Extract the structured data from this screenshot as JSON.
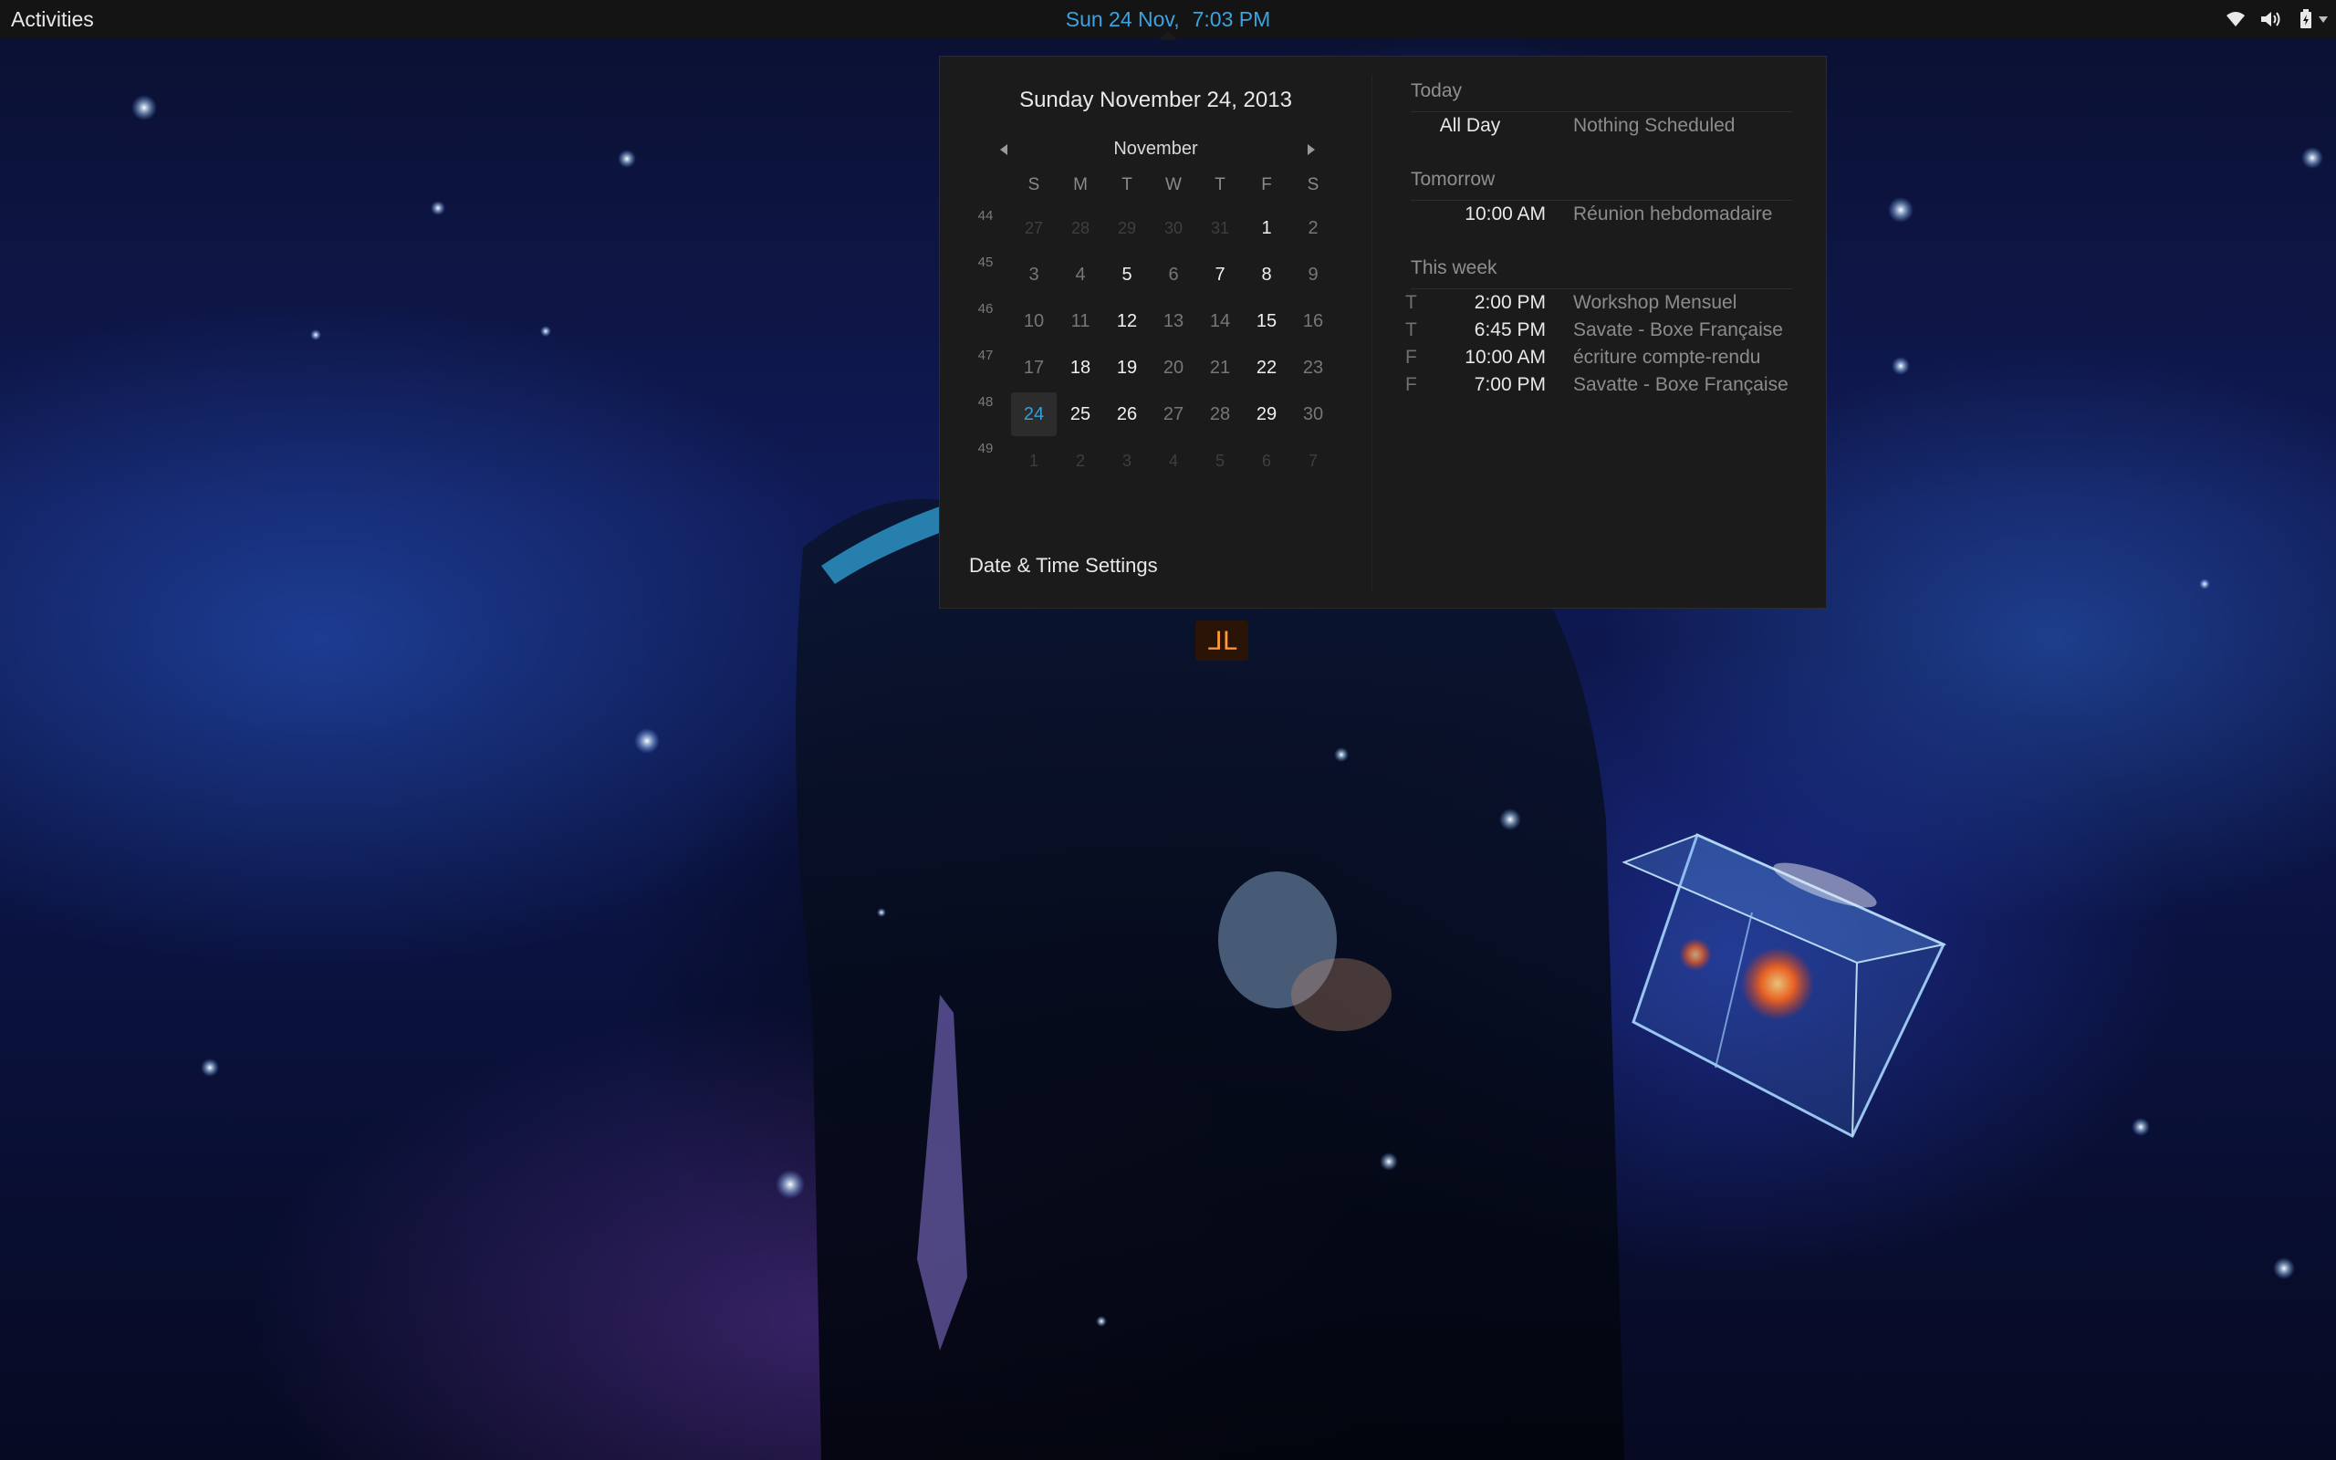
{
  "top_bar": {
    "activities_label": "Activities",
    "clock_date": "Sun 24 Nov,",
    "clock_time": "7:03 PM",
    "status_icons": [
      "wifi-icon",
      "volume-icon",
      "battery-icon",
      "dropdown-arrow-icon"
    ]
  },
  "calendar": {
    "full_date": "Sunday November 24, 2013",
    "month": "November",
    "weekdays": [
      "S",
      "M",
      "T",
      "W",
      "T",
      "F",
      "S"
    ],
    "week_numbers": [
      "44",
      "45",
      "46",
      "47",
      "48",
      "49"
    ],
    "weeks": [
      [
        {
          "d": "27",
          "t": "other"
        },
        {
          "d": "28",
          "t": "other"
        },
        {
          "d": "29",
          "t": "other"
        },
        {
          "d": "30",
          "t": "other"
        },
        {
          "d": "31",
          "t": "other"
        },
        {
          "d": "1",
          "t": "evt"
        },
        {
          "d": "2",
          "t": "plain"
        }
      ],
      [
        {
          "d": "3",
          "t": "plain"
        },
        {
          "d": "4",
          "t": "plain"
        },
        {
          "d": "5",
          "t": "evt"
        },
        {
          "d": "6",
          "t": "plain"
        },
        {
          "d": "7",
          "t": "evt"
        },
        {
          "d": "8",
          "t": "evt"
        },
        {
          "d": "9",
          "t": "plain"
        }
      ],
      [
        {
          "d": "10",
          "t": "plain"
        },
        {
          "d": "11",
          "t": "plain"
        },
        {
          "d": "12",
          "t": "evt"
        },
        {
          "d": "13",
          "t": "plain"
        },
        {
          "d": "14",
          "t": "plain"
        },
        {
          "d": "15",
          "t": "evt"
        },
        {
          "d": "16",
          "t": "plain"
        }
      ],
      [
        {
          "d": "17",
          "t": "plain"
        },
        {
          "d": "18",
          "t": "evt"
        },
        {
          "d": "19",
          "t": "evt"
        },
        {
          "d": "20",
          "t": "plain"
        },
        {
          "d": "21",
          "t": "plain"
        },
        {
          "d": "22",
          "t": "evt"
        },
        {
          "d": "23",
          "t": "plain"
        }
      ],
      [
        {
          "d": "24",
          "t": "today"
        },
        {
          "d": "25",
          "t": "evt"
        },
        {
          "d": "26",
          "t": "evt"
        },
        {
          "d": "27",
          "t": "plain"
        },
        {
          "d": "28",
          "t": "plain"
        },
        {
          "d": "29",
          "t": "evt"
        },
        {
          "d": "30",
          "t": "plain"
        }
      ],
      [
        {
          "d": "1",
          "t": "other"
        },
        {
          "d": "2",
          "t": "other"
        },
        {
          "d": "3",
          "t": "other"
        },
        {
          "d": "4",
          "t": "other"
        },
        {
          "d": "5",
          "t": "other"
        },
        {
          "d": "6",
          "t": "other"
        },
        {
          "d": "7",
          "t": "other"
        }
      ]
    ],
    "settings_label": "Date & Time Settings"
  },
  "events": {
    "today": {
      "title": "Today",
      "items": [
        {
          "day": "",
          "time": "All Day",
          "title": "Nothing Scheduled"
        }
      ]
    },
    "tomorrow": {
      "title": "Tomorrow",
      "items": [
        {
          "day": "",
          "time": "10:00 AM",
          "title": "Réunion hebdomadaire"
        }
      ]
    },
    "this_week": {
      "title": "This week",
      "items": [
        {
          "day": "T",
          "time": "2:00 PM",
          "title": "Workshop Mensuel"
        },
        {
          "day": "T",
          "time": "6:45 PM",
          "title": "Savate - Boxe Française"
        },
        {
          "day": "F",
          "time": "10:00 AM",
          "title": "écriture compte-rendu"
        },
        {
          "day": "F",
          "time": "7:00 PM",
          "title": "Savatte - Boxe Française"
        }
      ]
    }
  },
  "colors": {
    "accent": "#3aa3e0",
    "panel": "#141414",
    "popup": "#1b1b1b",
    "today_bg": "#2c2c2c"
  }
}
